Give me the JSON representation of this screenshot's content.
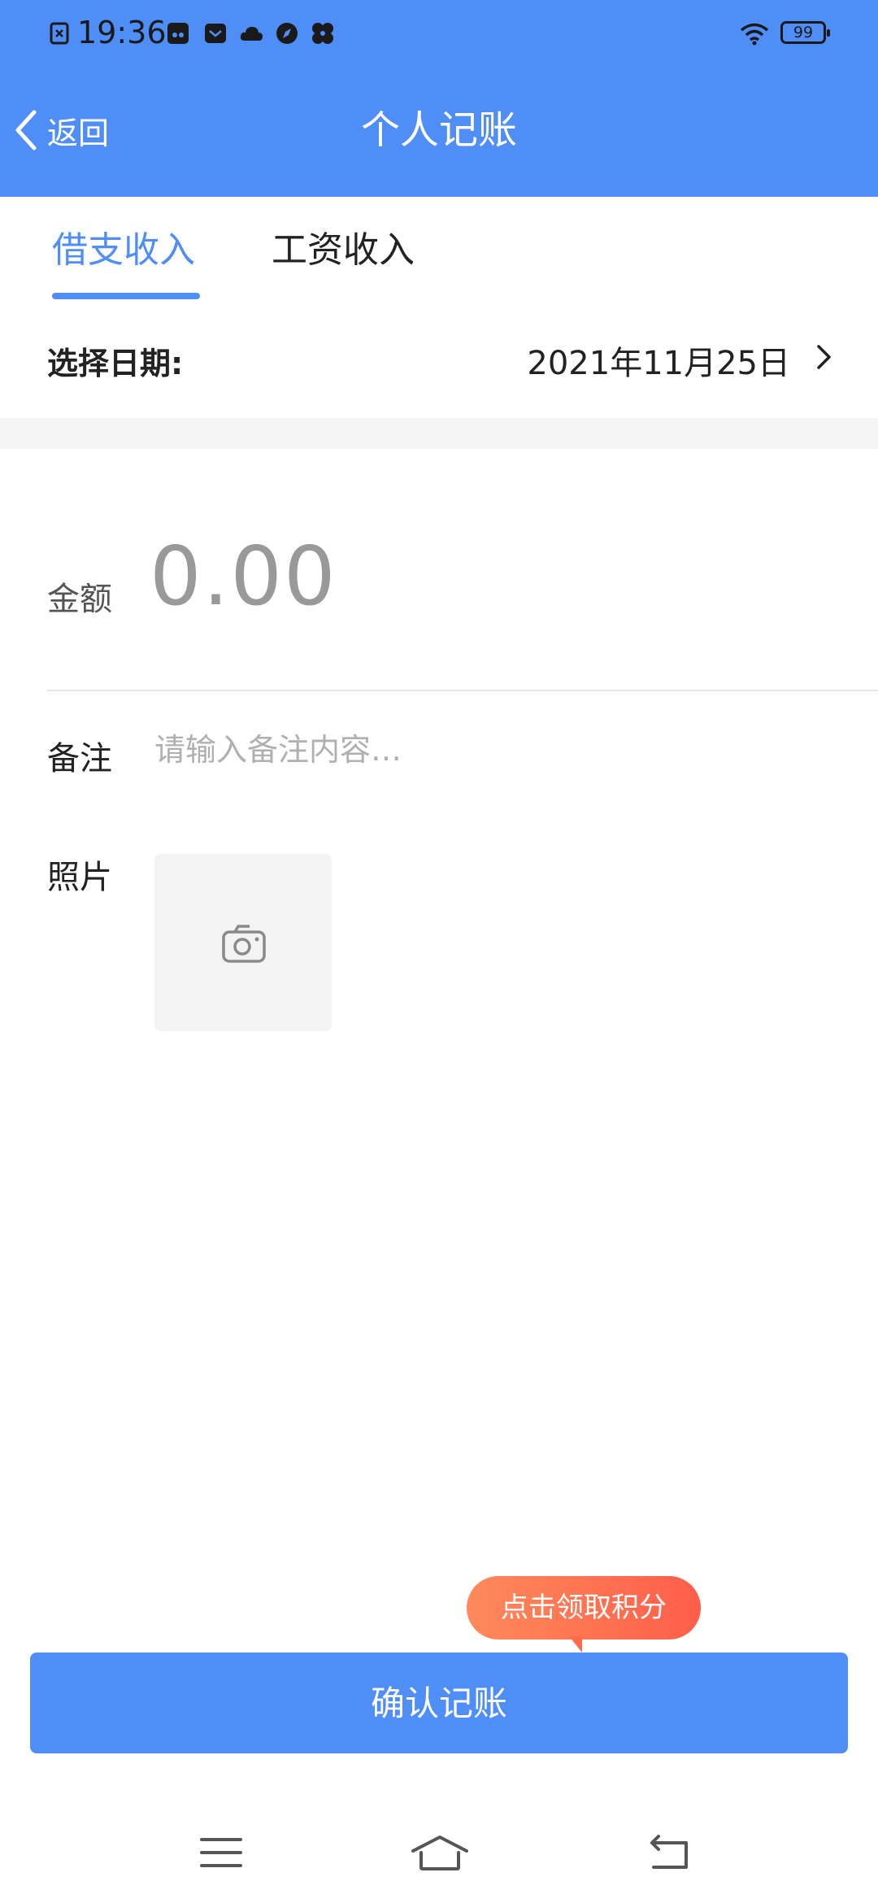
{
  "status_bar": {
    "time": "19:36",
    "battery": "99",
    "icons": [
      "sim-icon",
      "notification-icon",
      "mail-icon",
      "cloud-icon",
      "compass-icon",
      "fan-icon",
      "wifi-icon"
    ]
  },
  "header": {
    "back_label": "返回",
    "title": "个人记账",
    "background": "#4f8ef7"
  },
  "tabs": [
    {
      "label": "借支收入",
      "active": true
    },
    {
      "label": "工资收入",
      "active": false
    }
  ],
  "date_row": {
    "label": "选择日期:",
    "value": "2021年11月25日"
  },
  "form": {
    "amount_label": "金额",
    "amount_value": "0.00",
    "note_label": "备注",
    "note_placeholder": "请输入备注内容…",
    "note_value": "",
    "photo_label": "照片"
  },
  "reward_bubble": "点击领取积分",
  "confirm_button": "确认记账",
  "colors": {
    "accent": "#4f8ef7",
    "reward_gradient_start": "#ff8a5b",
    "reward_gradient_end": "#ff5e49"
  },
  "nav_bar": [
    "menu-icon",
    "home-icon",
    "back-icon"
  ]
}
